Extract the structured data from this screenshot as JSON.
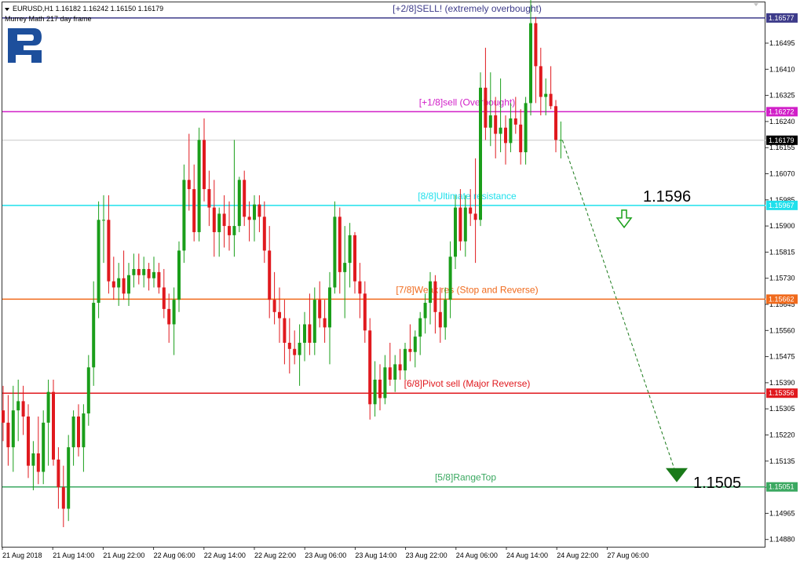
{
  "header": {
    "symbol_line": "EURUSD,H1  1.16182 1.16242 1.16150 1.16179",
    "indicator_line": "Murrey Math 217 day frame"
  },
  "colors": {
    "bull": "#1a9e1a",
    "bear": "#e0191e",
    "level_plus2": "#3d3b8a",
    "level_plus1": "#d11fc8",
    "level_8": "#1fe0ec",
    "level_7": "#f06a1c",
    "level_6": "#e0191e",
    "level_5": "#3aa860",
    "logo": "#1d4f9c",
    "forecast": "#1a7a1a"
  },
  "price_axis_labels": [
    "1.16495",
    "1.16410",
    "1.16325",
    "1.16240",
    "1.16155",
    "1.16070",
    "1.15985",
    "1.15900",
    "1.15815",
    "1.15730",
    "1.15645",
    "1.15560",
    "1.15475",
    "1.15390",
    "1.15305",
    "1.15220",
    "1.15135",
    "1.15050",
    "1.14965",
    "1.14880"
  ],
  "time_axis_labels": [
    "21 Aug 2018",
    "21 Aug 14:00",
    "21 Aug 22:00",
    "22 Aug 06:00",
    "22 Aug 14:00",
    "22 Aug 22:00",
    "23 Aug 06:00",
    "23 Aug 14:00",
    "23 Aug 22:00",
    "24 Aug 06:00",
    "24 Aug 14:00",
    "24 Aug 22:00",
    "27 Aug 06:00"
  ],
  "levels": [
    {
      "name": "plus2",
      "price": "1.16577",
      "text": "[+2/8]SELL! (extremely overbought)"
    },
    {
      "name": "plus1",
      "price": "1.16272",
      "text": "[+1/8]sell (Overbought)"
    },
    {
      "name": "eight",
      "price": "1.15967",
      "text": "[8/8]Ultimate resistance"
    },
    {
      "name": "seven",
      "price": "1.15662",
      "text": "[7/8]Weak res (Stop and Reverse)"
    },
    {
      "name": "six",
      "price": "1.15356",
      "text": "[6/8]Pivot sell (Major Reverse)"
    },
    {
      "name": "five",
      "price": "1.15051",
      "text": "[5/8]RangeTop"
    }
  ],
  "current_price": "1.16179",
  "forecast": {
    "upper_label": "1.1596",
    "lower_label": "1.1505"
  },
  "chart_data": {
    "type": "candlestick",
    "symbol": "EURUSD",
    "timeframe": "H1",
    "last_ohlc": {
      "open": 1.16182,
      "high": 1.16242,
      "low": 1.1615,
      "close": 1.16179
    },
    "candles": [
      {
        "o": 1.153,
        "h": 1.1538,
        "l": 1.152,
        "c": 1.1526
      },
      {
        "o": 1.1526,
        "h": 1.1535,
        "l": 1.1512,
        "c": 1.1518
      },
      {
        "o": 1.1518,
        "h": 1.1538,
        "l": 1.151,
        "c": 1.153
      },
      {
        "o": 1.153,
        "h": 1.154,
        "l": 1.152,
        "c": 1.1533
      },
      {
        "o": 1.1533,
        "h": 1.1538,
        "l": 1.1522,
        "c": 1.1528
      },
      {
        "o": 1.1528,
        "h": 1.1532,
        "l": 1.1508,
        "c": 1.1512
      },
      {
        "o": 1.1512,
        "h": 1.152,
        "l": 1.1504,
        "c": 1.1516
      },
      {
        "o": 1.1516,
        "h": 1.1528,
        "l": 1.1506,
        "c": 1.151
      },
      {
        "o": 1.151,
        "h": 1.153,
        "l": 1.1506,
        "c": 1.1526
      },
      {
        "o": 1.1526,
        "h": 1.154,
        "l": 1.1512,
        "c": 1.1536
      },
      {
        "o": 1.1536,
        "h": 1.154,
        "l": 1.1512,
        "c": 1.1514
      },
      {
        "o": 1.1514,
        "h": 1.1518,
        "l": 1.1498,
        "c": 1.1505
      },
      {
        "o": 1.1505,
        "h": 1.1512,
        "l": 1.1492,
        "c": 1.1498
      },
      {
        "o": 1.1498,
        "h": 1.1522,
        "l": 1.1494,
        "c": 1.1518
      },
      {
        "o": 1.1518,
        "h": 1.153,
        "l": 1.1512,
        "c": 1.1528
      },
      {
        "o": 1.1528,
        "h": 1.1532,
        "l": 1.1515,
        "c": 1.1518
      },
      {
        "o": 1.1518,
        "h": 1.1532,
        "l": 1.151,
        "c": 1.1529
      },
      {
        "o": 1.1529,
        "h": 1.1548,
        "l": 1.1525,
        "c": 1.1544
      },
      {
        "o": 1.1544,
        "h": 1.1572,
        "l": 1.1538,
        "c": 1.1565
      },
      {
        "o": 1.1565,
        "h": 1.1598,
        "l": 1.156,
        "c": 1.1592
      },
      {
        "o": 1.1592,
        "h": 1.16,
        "l": 1.1578,
        "c": 1.1592
      },
      {
        "o": 1.1592,
        "h": 1.16,
        "l": 1.1568,
        "c": 1.1572
      },
      {
        "o": 1.1572,
        "h": 1.158,
        "l": 1.1566,
        "c": 1.157
      },
      {
        "o": 1.157,
        "h": 1.1578,
        "l": 1.1564,
        "c": 1.1573
      },
      {
        "o": 1.1573,
        "h": 1.1582,
        "l": 1.1566,
        "c": 1.1568
      },
      {
        "o": 1.1568,
        "h": 1.1578,
        "l": 1.1564,
        "c": 1.1574
      },
      {
        "o": 1.1574,
        "h": 1.1581,
        "l": 1.157,
        "c": 1.1576
      },
      {
        "o": 1.1576,
        "h": 1.1581,
        "l": 1.1571,
        "c": 1.1574
      },
      {
        "o": 1.1574,
        "h": 1.158,
        "l": 1.157,
        "c": 1.1576
      },
      {
        "o": 1.1576,
        "h": 1.1578,
        "l": 1.1569,
        "c": 1.1573
      },
      {
        "o": 1.1573,
        "h": 1.158,
        "l": 1.157,
        "c": 1.1575
      },
      {
        "o": 1.1575,
        "h": 1.1578,
        "l": 1.1568,
        "c": 1.157
      },
      {
        "o": 1.157,
        "h": 1.1576,
        "l": 1.156,
        "c": 1.1563
      },
      {
        "o": 1.1563,
        "h": 1.1568,
        "l": 1.1552,
        "c": 1.1558
      },
      {
        "o": 1.1558,
        "h": 1.157,
        "l": 1.1548,
        "c": 1.1566
      },
      {
        "o": 1.1566,
        "h": 1.1585,
        "l": 1.1562,
        "c": 1.1582
      },
      {
        "o": 1.1582,
        "h": 1.161,
        "l": 1.1578,
        "c": 1.1605
      },
      {
        "o": 1.1605,
        "h": 1.162,
        "l": 1.1595,
        "c": 1.1602
      },
      {
        "o": 1.1602,
        "h": 1.161,
        "l": 1.1585,
        "c": 1.1588
      },
      {
        "o": 1.1588,
        "h": 1.1622,
        "l": 1.1585,
        "c": 1.1618
      },
      {
        "o": 1.1618,
        "h": 1.1625,
        "l": 1.1598,
        "c": 1.1602
      },
      {
        "o": 1.1602,
        "h": 1.1608,
        "l": 1.159,
        "c": 1.1596
      },
      {
        "o": 1.1596,
        "h": 1.1605,
        "l": 1.158,
        "c": 1.1588
      },
      {
        "o": 1.1588,
        "h": 1.1596,
        "l": 1.158,
        "c": 1.1594
      },
      {
        "o": 1.1594,
        "h": 1.16,
        "l": 1.1583,
        "c": 1.159
      },
      {
        "o": 1.159,
        "h": 1.1598,
        "l": 1.1582,
        "c": 1.1587
      },
      {
        "o": 1.1587,
        "h": 1.1618,
        "l": 1.158,
        "c": 1.159
      },
      {
        "o": 1.159,
        "h": 1.1606,
        "l": 1.1588,
        "c": 1.1605
      },
      {
        "o": 1.1605,
        "h": 1.1608,
        "l": 1.159,
        "c": 1.1593
      },
      {
        "o": 1.1593,
        "h": 1.1598,
        "l": 1.1585,
        "c": 1.1592
      },
      {
        "o": 1.1592,
        "h": 1.16,
        "l": 1.1585,
        "c": 1.1597
      },
      {
        "o": 1.1597,
        "h": 1.16,
        "l": 1.1588,
        "c": 1.1593
      },
      {
        "o": 1.1593,
        "h": 1.1598,
        "l": 1.1578,
        "c": 1.1582
      },
      {
        "o": 1.1582,
        "h": 1.159,
        "l": 1.156,
        "c": 1.1566
      },
      {
        "o": 1.1566,
        "h": 1.1575,
        "l": 1.1558,
        "c": 1.1562
      },
      {
        "o": 1.1562,
        "h": 1.157,
        "l": 1.1552,
        "c": 1.156
      },
      {
        "o": 1.156,
        "h": 1.1566,
        "l": 1.1545,
        "c": 1.1552
      },
      {
        "o": 1.1552,
        "h": 1.156,
        "l": 1.1542,
        "c": 1.155
      },
      {
        "o": 1.155,
        "h": 1.1556,
        "l": 1.1545,
        "c": 1.1548
      },
      {
        "o": 1.1548,
        "h": 1.1558,
        "l": 1.1538,
        "c": 1.1552
      },
      {
        "o": 1.1552,
        "h": 1.1562,
        "l": 1.1546,
        "c": 1.1558
      },
      {
        "o": 1.1558,
        "h": 1.1568,
        "l": 1.1548,
        "c": 1.1552
      },
      {
        "o": 1.1552,
        "h": 1.157,
        "l": 1.1548,
        "c": 1.1566
      },
      {
        "o": 1.1566,
        "h": 1.1572,
        "l": 1.1557,
        "c": 1.156
      },
      {
        "o": 1.156,
        "h": 1.1566,
        "l": 1.1552,
        "c": 1.1557
      },
      {
        "o": 1.1557,
        "h": 1.1575,
        "l": 1.1545,
        "c": 1.157
      },
      {
        "o": 1.157,
        "h": 1.1598,
        "l": 1.1568,
        "c": 1.1593
      },
      {
        "o": 1.1593,
        "h": 1.1596,
        "l": 1.1568,
        "c": 1.1575
      },
      {
        "o": 1.1575,
        "h": 1.159,
        "l": 1.156,
        "c": 1.1578
      },
      {
        "o": 1.1578,
        "h": 1.1591,
        "l": 1.157,
        "c": 1.1587
      },
      {
        "o": 1.1587,
        "h": 1.1588,
        "l": 1.1568,
        "c": 1.1572
      },
      {
        "o": 1.1572,
        "h": 1.1578,
        "l": 1.156,
        "c": 1.1568
      },
      {
        "o": 1.1568,
        "h": 1.1572,
        "l": 1.1552,
        "c": 1.1556
      },
      {
        "o": 1.1556,
        "h": 1.156,
        "l": 1.1527,
        "c": 1.1532
      },
      {
        "o": 1.1532,
        "h": 1.1546,
        "l": 1.1528,
        "c": 1.154
      },
      {
        "o": 1.154,
        "h": 1.1545,
        "l": 1.153,
        "c": 1.1534
      },
      {
        "o": 1.1534,
        "h": 1.1548,
        "l": 1.1532,
        "c": 1.1544
      },
      {
        "o": 1.1544,
        "h": 1.1552,
        "l": 1.1538,
        "c": 1.154
      },
      {
        "o": 1.154,
        "h": 1.1548,
        "l": 1.1536,
        "c": 1.1545
      },
      {
        "o": 1.1545,
        "h": 1.155,
        "l": 1.154,
        "c": 1.1543
      },
      {
        "o": 1.1543,
        "h": 1.1552,
        "l": 1.154,
        "c": 1.155
      },
      {
        "o": 1.155,
        "h": 1.1558,
        "l": 1.1546,
        "c": 1.1549
      },
      {
        "o": 1.1549,
        "h": 1.1556,
        "l": 1.1544,
        "c": 1.1554
      },
      {
        "o": 1.1554,
        "h": 1.1562,
        "l": 1.1548,
        "c": 1.156
      },
      {
        "o": 1.156,
        "h": 1.1568,
        "l": 1.1555,
        "c": 1.1565
      },
      {
        "o": 1.1565,
        "h": 1.1575,
        "l": 1.1558,
        "c": 1.1572
      },
      {
        "o": 1.1572,
        "h": 1.1574,
        "l": 1.1555,
        "c": 1.1562
      },
      {
        "o": 1.1562,
        "h": 1.157,
        "l": 1.1552,
        "c": 1.1557
      },
      {
        "o": 1.1557,
        "h": 1.157,
        "l": 1.1553,
        "c": 1.1566
      },
      {
        "o": 1.1566,
        "h": 1.1585,
        "l": 1.156,
        "c": 1.158
      },
      {
        "o": 1.158,
        "h": 1.16,
        "l": 1.1576,
        "c": 1.1596
      },
      {
        "o": 1.1596,
        "h": 1.1602,
        "l": 1.1582,
        "c": 1.1585
      },
      {
        "o": 1.1585,
        "h": 1.16,
        "l": 1.158,
        "c": 1.1596
      },
      {
        "o": 1.1596,
        "h": 1.1602,
        "l": 1.159,
        "c": 1.1594
      },
      {
        "o": 1.1594,
        "h": 1.1612,
        "l": 1.1578,
        "c": 1.1592
      },
      {
        "o": 1.1592,
        "h": 1.164,
        "l": 1.159,
        "c": 1.1635
      },
      {
        "o": 1.1635,
        "h": 1.1648,
        "l": 1.1618,
        "c": 1.1622
      },
      {
        "o": 1.1622,
        "h": 1.164,
        "l": 1.1616,
        "c": 1.1626
      },
      {
        "o": 1.1626,
        "h": 1.1632,
        "l": 1.1612,
        "c": 1.162
      },
      {
        "o": 1.162,
        "h": 1.1638,
        "l": 1.1614,
        "c": 1.1622
      },
      {
        "o": 1.1622,
        "h": 1.1626,
        "l": 1.161,
        "c": 1.1617
      },
      {
        "o": 1.1617,
        "h": 1.163,
        "l": 1.1614,
        "c": 1.1625
      },
      {
        "o": 1.1625,
        "h": 1.1632,
        "l": 1.162,
        "c": 1.1623
      },
      {
        "o": 1.1623,
        "h": 1.1628,
        "l": 1.161,
        "c": 1.1614
      },
      {
        "o": 1.1614,
        "h": 1.1632,
        "l": 1.161,
        "c": 1.163
      },
      {
        "o": 1.163,
        "h": 1.1668,
        "l": 1.1626,
        "c": 1.1656
      },
      {
        "o": 1.1656,
        "h": 1.1658,
        "l": 1.163,
        "c": 1.1642
      },
      {
        "o": 1.1642,
        "h": 1.1648,
        "l": 1.1626,
        "c": 1.1632
      },
      {
        "o": 1.1632,
        "h": 1.1638,
        "l": 1.1626,
        "c": 1.1633
      },
      {
        "o": 1.1633,
        "h": 1.1642,
        "l": 1.1628,
        "c": 1.1629
      },
      {
        "o": 1.1629,
        "h": 1.1631,
        "l": 1.1614,
        "c": 1.1618
      },
      {
        "o": 1.1618,
        "h": 1.1624,
        "l": 1.1612,
        "c": 1.1618
      }
    ]
  }
}
